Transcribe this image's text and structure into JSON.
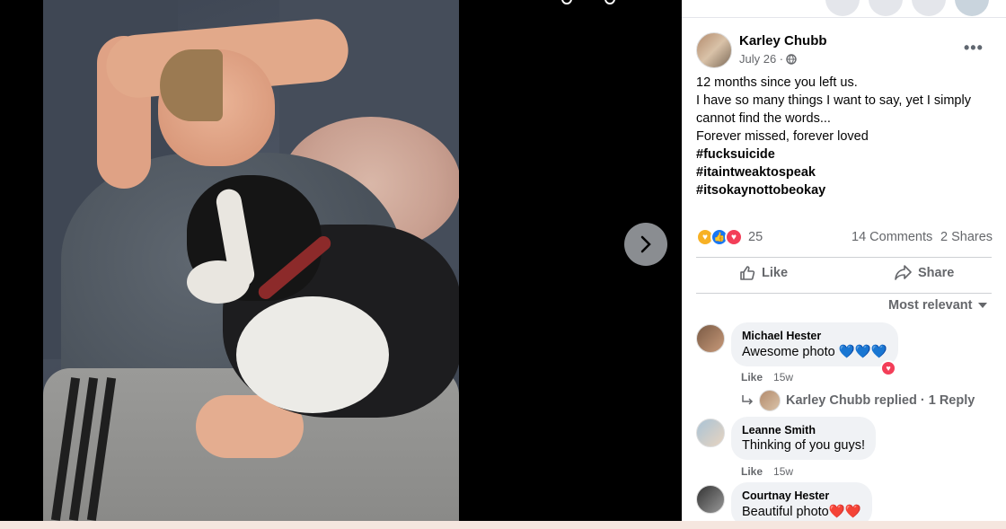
{
  "post": {
    "author": "Karley Chubb",
    "date": "July 26 ·",
    "lines": [
      "12 months since you left us.",
      "I have so many things I want to say, yet I simply",
      "cannot find the words...",
      "Forever missed, forever loved"
    ],
    "hashtags": [
      "#fucksuicide",
      "#itaintweaktospeak",
      "#itsokaynottobeokay"
    ],
    "reaction_count": "25",
    "comments_label": "14 Comments",
    "shares_label": "2 Shares"
  },
  "actions": {
    "like": "Like",
    "share": "Share"
  },
  "sort_label": "Most relevant",
  "comments": [
    {
      "name": "Michael Hester",
      "text": "Awesome photo 💙💙💙",
      "like": "Like",
      "time": "15w"
    },
    {
      "name": "Leanne Smith",
      "text": "Thinking of you guys!",
      "like": "Like",
      "time": "15w"
    },
    {
      "name": "Courtnay Hester",
      "text": "Beautiful photo❤️❤️"
    }
  ],
  "reply_summary": "Karley Chubb replied · 1 Reply",
  "colors": {
    "link_blue": "#1877f2",
    "heart": "#f33e58",
    "muted": "#65676b"
  }
}
